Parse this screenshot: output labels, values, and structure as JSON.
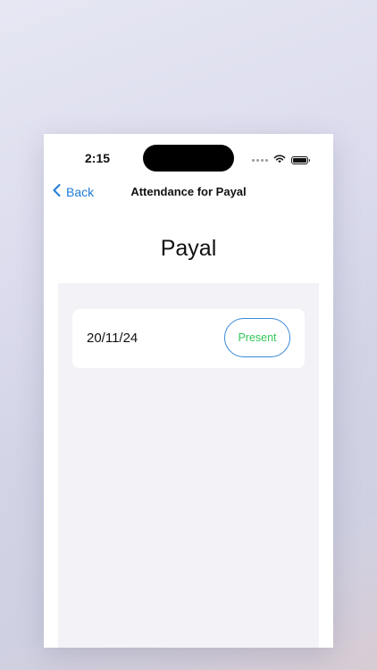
{
  "status_bar": {
    "time": "2:15"
  },
  "nav": {
    "back_label": "Back",
    "title": "Attendance for Payal"
  },
  "page": {
    "title": "Payal"
  },
  "records": [
    {
      "date": "20/11/24",
      "status": "Present"
    }
  ],
  "colors": {
    "accent": "#1f7bd7",
    "present": "#34c759",
    "panel_background": "#f2f2f7"
  },
  "icons": {
    "back": "chevron-left-icon",
    "wifi": "wifi-icon",
    "battery": "battery-icon",
    "signal": "signal-dots-icon"
  }
}
